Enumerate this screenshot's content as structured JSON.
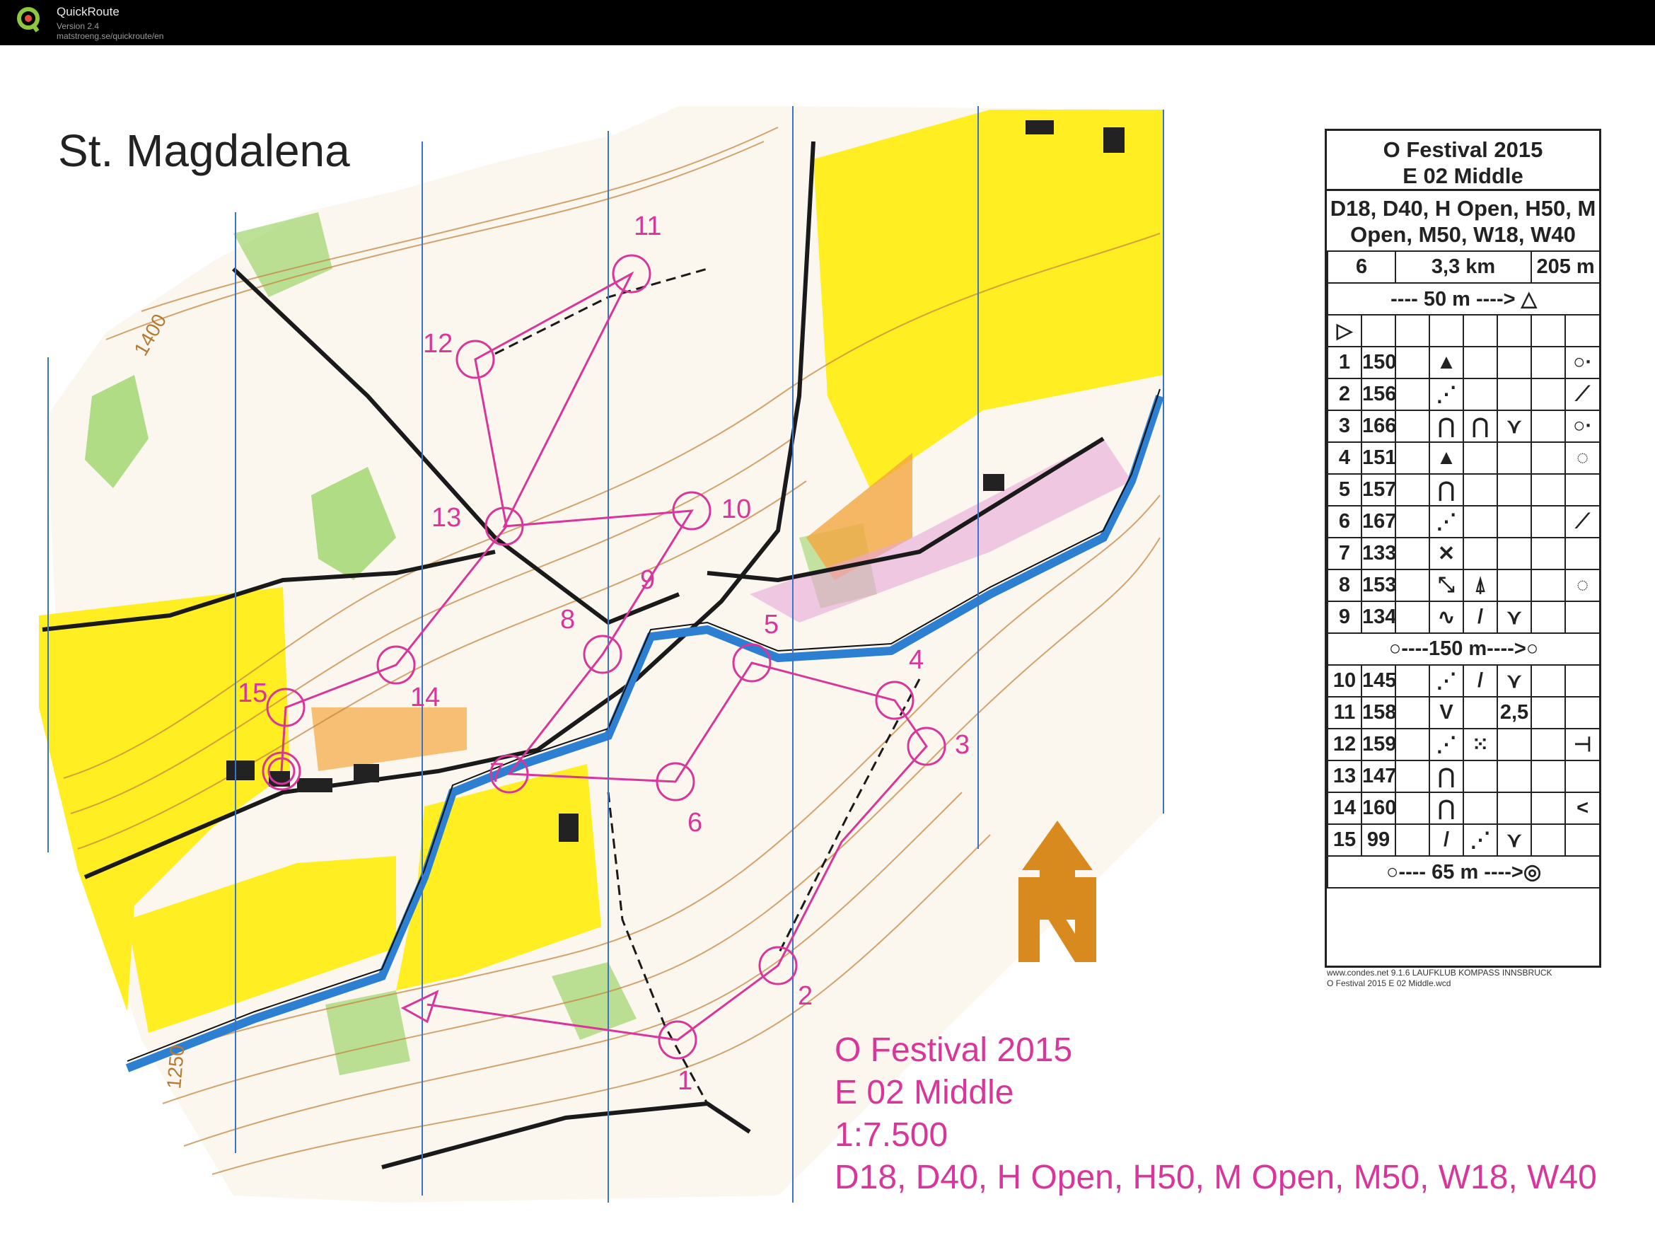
{
  "app": {
    "name": "QuickRoute",
    "version": "Version 2.4",
    "url": "matstroeng.se/quickroute/en"
  },
  "map": {
    "title": "St. Magdalena",
    "contour_labels": [
      "1400",
      "1250"
    ],
    "overprint_color": "#d8369a",
    "control_labels": [
      "1",
      "2",
      "3",
      "4",
      "5",
      "6",
      "7",
      "8",
      "9",
      "10",
      "11",
      "12",
      "13",
      "14",
      "15"
    ],
    "info": {
      "event": "O Festival 2015",
      "course": "E 02 Middle",
      "scale": "1:7.500",
      "classes": "D18, D40, H Open, H50, M Open, M50, W18, W40"
    }
  },
  "control_descriptions": {
    "event": "O Festival 2015",
    "course": "E 02 Middle",
    "classes": "D18, D40, H Open, H50, M Open, M50, W18, W40",
    "course_number": "6",
    "length": "3,3 km",
    "climb": "205 m",
    "start_taped": "----  50 m  ---->",
    "taped_middle": "----150 m---->",
    "finish_taped": "----  65 m  ---->",
    "controls": [
      {
        "num": "1",
        "code": "150",
        "symbols": [
          "▲",
          "",
          "",
          "",
          "○·"
        ]
      },
      {
        "num": "2",
        "code": "156",
        "symbols": [
          "⋰",
          "",
          "",
          "",
          "⟋"
        ]
      },
      {
        "num": "3",
        "code": "166",
        "symbols": [
          "⋂",
          "⋂",
          "⋎",
          "",
          "○·"
        ]
      },
      {
        "num": "4",
        "code": "151",
        "symbols": [
          "▲",
          "",
          "",
          "",
          "◌"
        ]
      },
      {
        "num": "5",
        "code": "157",
        "symbols": [
          "⋂",
          "",
          "",
          "",
          ""
        ]
      },
      {
        "num": "6",
        "code": "167",
        "symbols": [
          "⋰",
          "",
          "",
          "",
          "⟋"
        ]
      },
      {
        "num": "7",
        "code": "133",
        "symbols": [
          "✕",
          "",
          "",
          "",
          ""
        ]
      },
      {
        "num": "8",
        "code": "153",
        "symbols": [
          "⤡",
          "⍋",
          "",
          "",
          "◌"
        ]
      },
      {
        "num": "9",
        "code": "134",
        "symbols": [
          "∿",
          "/",
          "⋎",
          "",
          ""
        ]
      },
      {
        "num": "10",
        "code": "145",
        "symbols": [
          "⋰",
          "/",
          "⋎",
          "",
          ""
        ]
      },
      {
        "num": "11",
        "code": "158",
        "symbols": [
          "V",
          "",
          "2,5",
          "",
          ""
        ]
      },
      {
        "num": "12",
        "code": "159",
        "symbols": [
          "⋰",
          "⁙",
          "",
          "",
          "⊣"
        ]
      },
      {
        "num": "13",
        "code": "147",
        "symbols": [
          "⋂",
          "",
          "",
          "",
          ""
        ]
      },
      {
        "num": "14",
        "code": "160",
        "symbols": [
          "⋂",
          "",
          "",
          "",
          "<"
        ]
      },
      {
        "num": "15",
        "code": "99",
        "symbols": [
          "/",
          "⋰",
          "⋎",
          "",
          ""
        ]
      }
    ],
    "footer_line1": "www.condes.net 9.1.6 LAUFKLUB KOMPASS INNSBRUCK",
    "footer_line2": "O Festival 2015 E 02 Middle.wcd"
  }
}
